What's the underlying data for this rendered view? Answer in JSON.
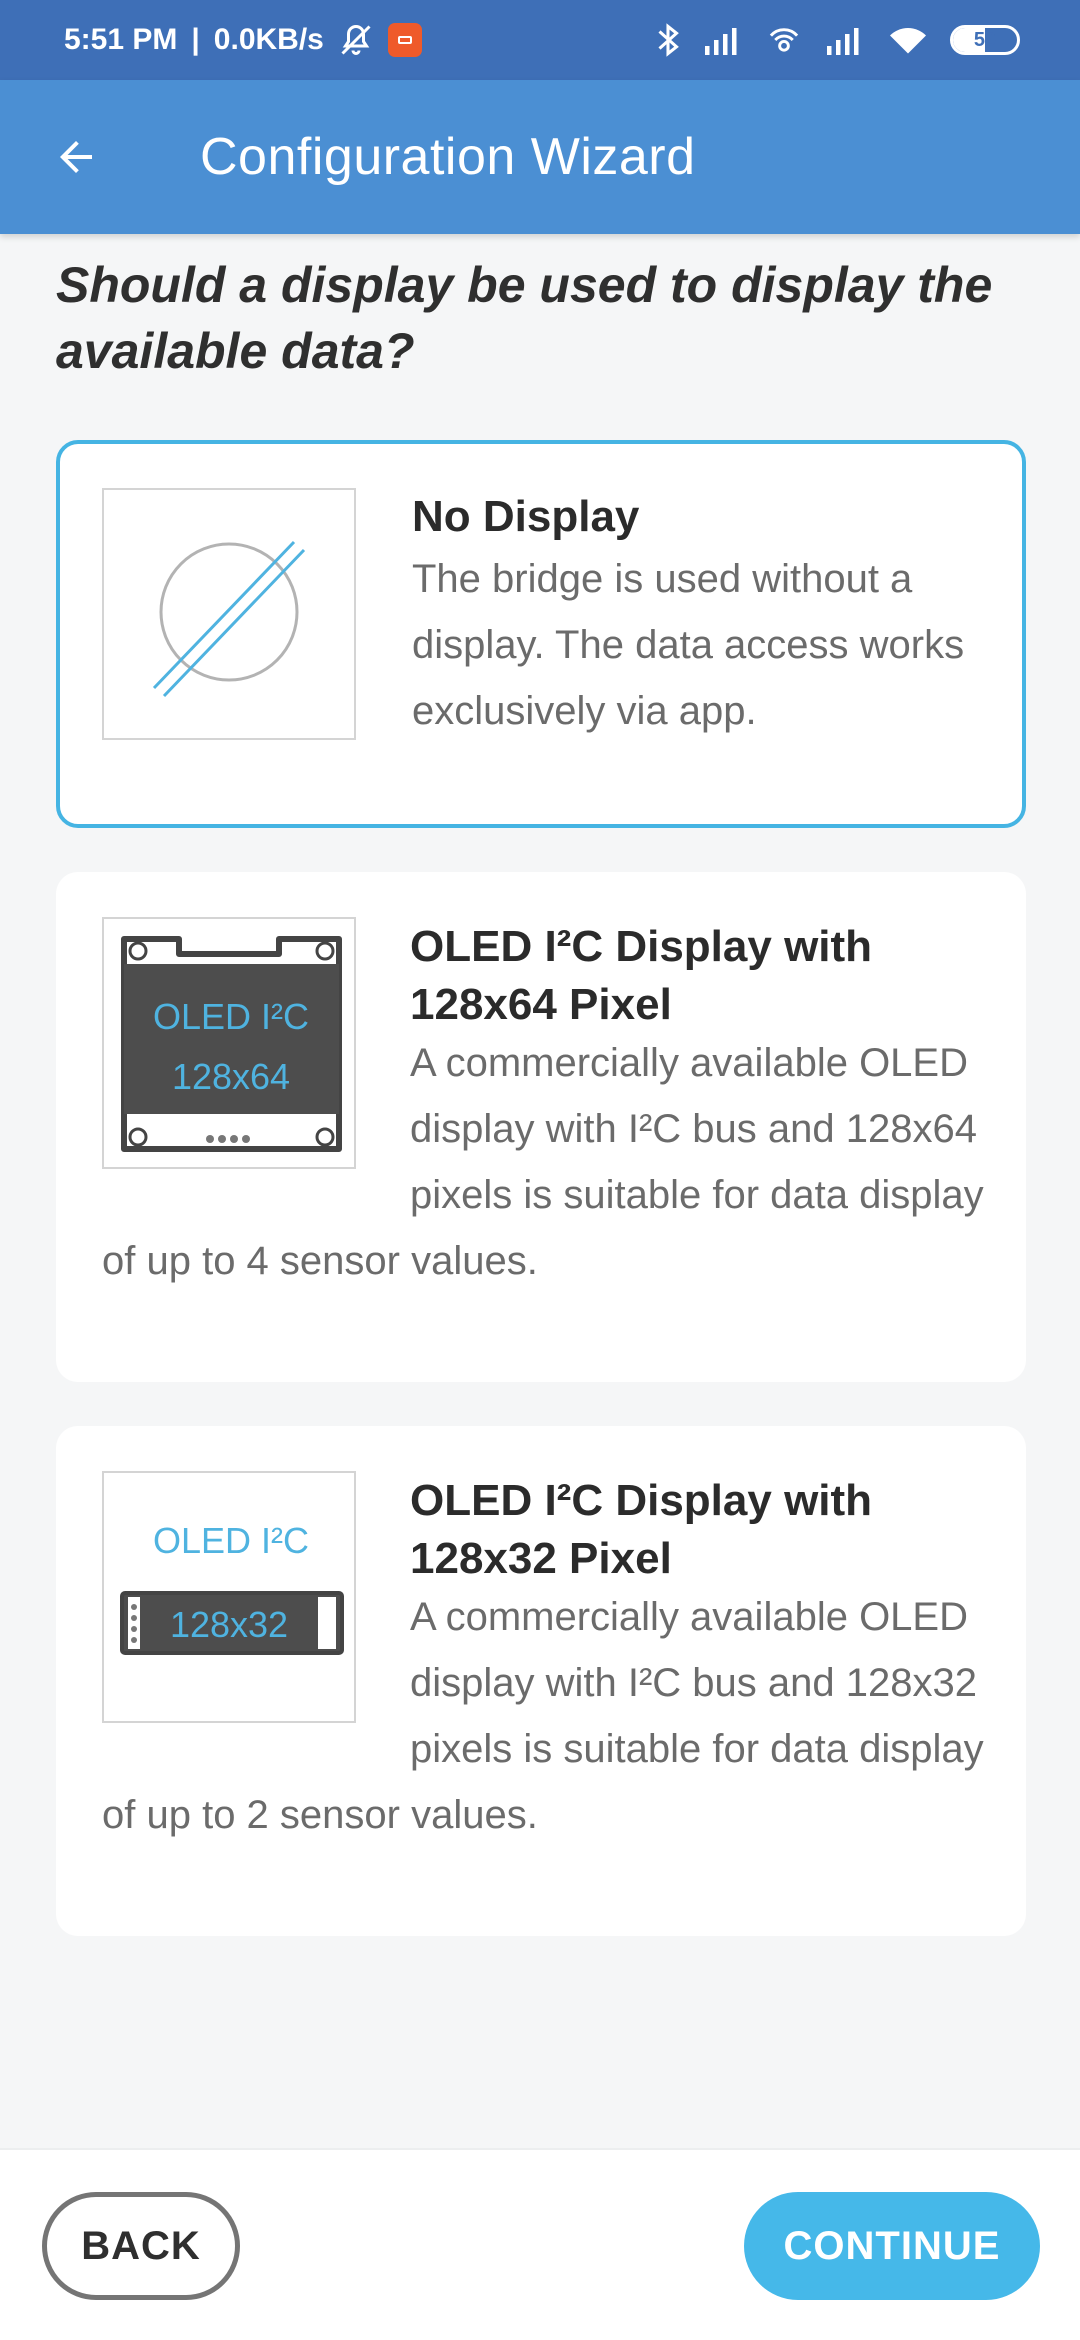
{
  "status_bar": {
    "time": "5:51 PM",
    "net_speed": "0.0KB/s",
    "battery": "50",
    "battery_level": 0.5
  },
  "app_bar": {
    "title": "Configuration Wizard",
    "back_icon": "arrow-left-icon"
  },
  "question": "Should a display be used to display the available data?",
  "options": [
    {
      "title": "No Display",
      "description": "The bridge is used without a display. The data access works exclusively via app.",
      "selected": true
    },
    {
      "title": "OLED I²C Display with 128x64 Pixel",
      "description": "A commercially available OLED display with I²C bus and 128x64 pixels is suitable for data display of up to 4 sensor values.",
      "image_line1": "OLED I²C",
      "image_line2": "128x64",
      "selected": false
    },
    {
      "title": "OLED I²C Display with 128x32 Pixel",
      "description": "A commercially available OLED display with I²C bus and 128x32 pixels is suitable for data display of up to 2 sensor values.",
      "image_line1": "OLED I²C",
      "image_line2": "128x32",
      "selected": false
    }
  ],
  "buttons": {
    "back": "BACK",
    "continue": "CONTINUE"
  },
  "colors": {
    "status_bar": "#3e6fb7",
    "app_bar": "#4b8fd3",
    "accent": "#45b4e3",
    "continue_button": "#45b8e9"
  }
}
